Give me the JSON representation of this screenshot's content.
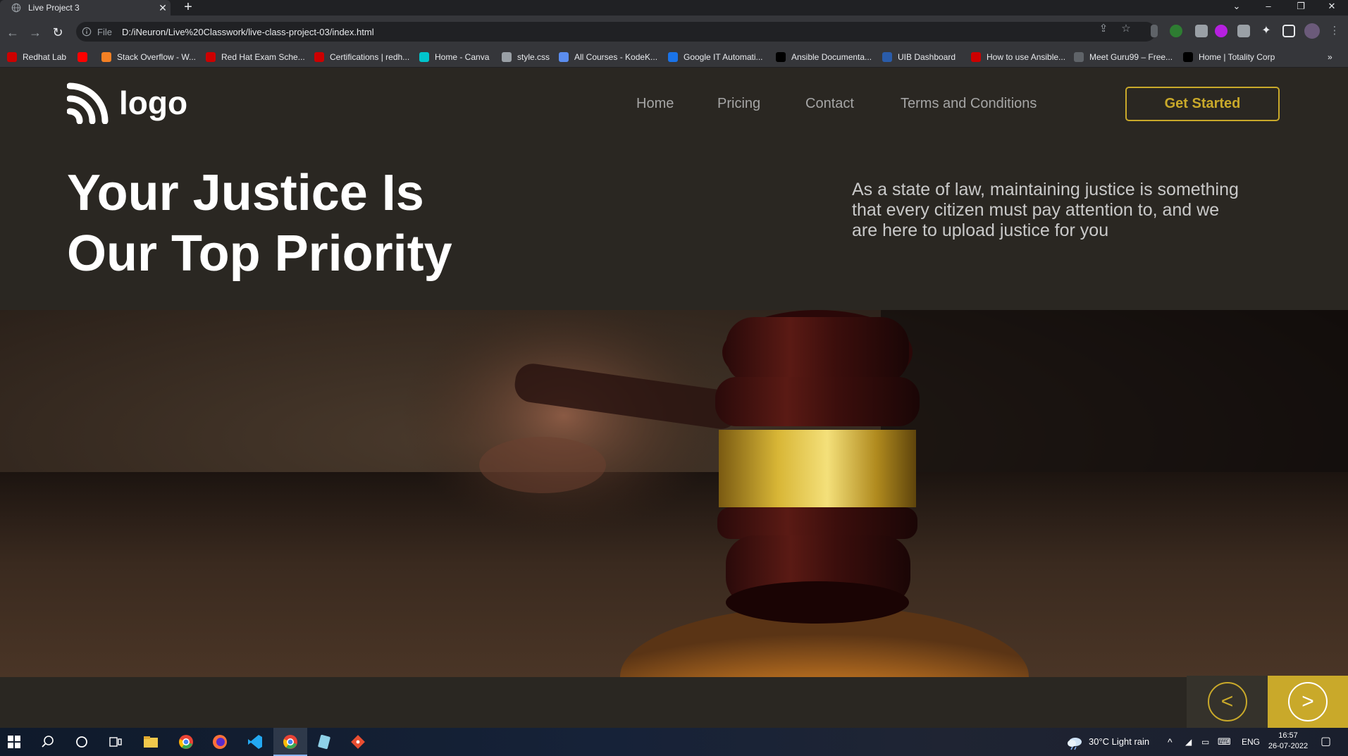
{
  "browser": {
    "tab_title": "Live Project 3",
    "tab_close": "✕",
    "new_tab": "+",
    "scheme_label": "File",
    "url": "D:/iNeuron/Live%20Classwork/live-class-project-03/index.html",
    "bookmarks": [
      {
        "label": "Redhat Lab",
        "color": "#cc0000"
      },
      {
        "label": "",
        "color": "#ff0000"
      },
      {
        "label": "Stack Overflow - W...",
        "color": "#f48024"
      },
      {
        "label": "Red Hat Exam Sche...",
        "color": "#cc0000"
      },
      {
        "label": "Certifications | redh...",
        "color": "#cc0000"
      },
      {
        "label": "Home - Canva",
        "color": "#00c4cc"
      },
      {
        "label": "style.css",
        "color": "#9aa0a6"
      },
      {
        "label": "All Courses - KodeK...",
        "color": "#5b8def"
      },
      {
        "label": "Google IT Automati...",
        "color": "#1a73e8"
      },
      {
        "label": "Ansible Documenta...",
        "color": "#000000"
      },
      {
        "label": "UIB Dashboard",
        "color": "#2a5caa"
      },
      {
        "label": "How to use Ansible...",
        "color": "#cc0000"
      },
      {
        "label": "Meet Guru99 – Free...",
        "color": "#5f6368"
      },
      {
        "label": "Home | Totality Corp",
        "color": "#000000"
      }
    ],
    "bookmarks_overflow": "»"
  },
  "site": {
    "logo_text": "logo",
    "nav": [
      "Home",
      "Pricing",
      "Contact",
      "Terms and Conditions"
    ],
    "cta_label": "Get Started",
    "hero_title_line1": "Your Justice Is",
    "hero_title_line2": "Our Top Priority",
    "hero_description": "As a state of law, maintaining justice is something that every citizen must pay attention to, and we are here to upload justice for you",
    "prev_arrow": "<",
    "next_arrow": ">",
    "accent_color": "#c9a92a",
    "bg_color": "#2a2722"
  },
  "taskbar": {
    "weather": "30°C  Light rain",
    "language": "ENG",
    "time": "16:57",
    "date": "26-07-2022"
  }
}
